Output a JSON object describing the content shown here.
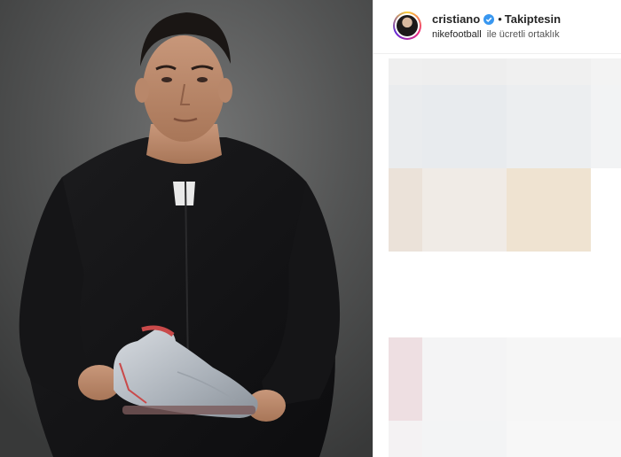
{
  "post": {
    "username": "cristiano",
    "separator": "•",
    "follow_label": "Takiptesin",
    "partner_name": "nikefootball",
    "partner_text": "ile ücretli ortaklık"
  },
  "icons": {
    "verified": "verified-badge-icon",
    "avatar": "profile-avatar"
  },
  "colors": {
    "verified_blue": "#3897f0",
    "text_primary": "#262626"
  }
}
